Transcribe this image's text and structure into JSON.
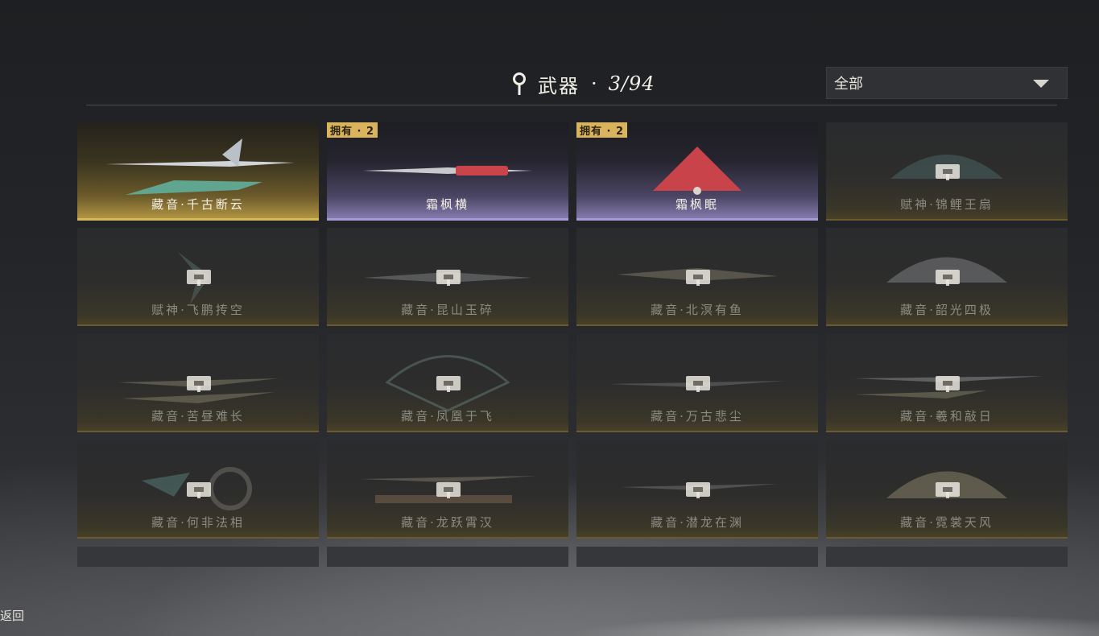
{
  "header": {
    "icon": "location-pin-icon",
    "title": "武器",
    "separator": "·",
    "count": "3/94"
  },
  "filter": {
    "selected": "全部",
    "icon": "chevron-down-icon"
  },
  "weapons": [
    {
      "name": "藏音·千古断云",
      "rarity": "gold",
      "owned": true,
      "badge": ""
    },
    {
      "name": "霜枫横",
      "rarity": "purple",
      "owned": true,
      "badge": "拥有 · 2"
    },
    {
      "name": "霜枫眠",
      "rarity": "purple",
      "owned": true,
      "badge": "拥有 · 2"
    },
    {
      "name": "赋神·锦鲤王扇",
      "rarity": "gold",
      "owned": false,
      "badge": ""
    },
    {
      "name": "赋神·飞鹏抟空",
      "rarity": "gold",
      "owned": false,
      "badge": ""
    },
    {
      "name": "藏音·昆山玉碎",
      "rarity": "gold",
      "owned": false,
      "badge": ""
    },
    {
      "name": "藏音·北溟有鱼",
      "rarity": "gold",
      "owned": false,
      "badge": ""
    },
    {
      "name": "藏音·韶光四极",
      "rarity": "gold",
      "owned": false,
      "badge": ""
    },
    {
      "name": "藏音·苦昼难长",
      "rarity": "gold",
      "owned": false,
      "badge": ""
    },
    {
      "name": "藏音·凤凰于飞",
      "rarity": "gold",
      "owned": false,
      "badge": ""
    },
    {
      "name": "藏音·万古悲尘",
      "rarity": "gold",
      "owned": false,
      "badge": ""
    },
    {
      "name": "藏音·羲和敲日",
      "rarity": "gold",
      "owned": false,
      "badge": ""
    },
    {
      "name": "藏音·何非法相",
      "rarity": "gold",
      "owned": false,
      "badge": ""
    },
    {
      "name": "藏音·龙跃霄汉",
      "rarity": "gold",
      "owned": false,
      "badge": ""
    },
    {
      "name": "藏音·潜龙在渊",
      "rarity": "gold",
      "owned": false,
      "badge": ""
    },
    {
      "name": "藏音·霓裳天风",
      "rarity": "gold",
      "owned": false,
      "badge": ""
    }
  ],
  "partial_row_count": 4,
  "footer": {
    "back_label": "返回"
  },
  "colors": {
    "gold_accent": "#d7b658",
    "purple_accent": "#a699d6",
    "badge": "#d9b45c"
  }
}
